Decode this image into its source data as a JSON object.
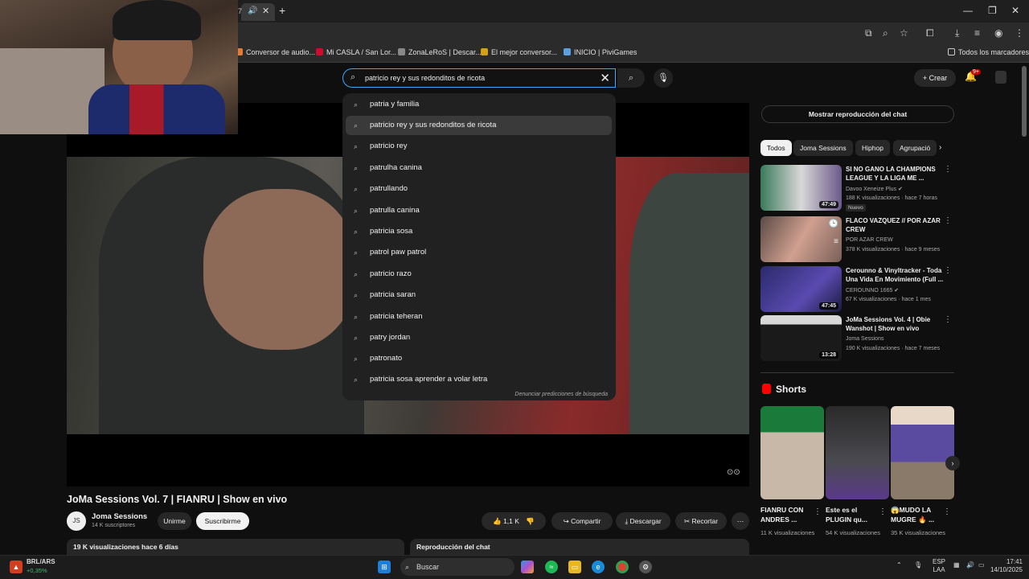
{
  "browser": {
    "tab_number": "7",
    "bookmarks": [
      {
        "label": "Conversor de audio...",
        "color": "#e07b39"
      },
      {
        "label": "Mi CASLA / San Lor...",
        "color": "#c8102e"
      },
      {
        "label": "ZonaLeRoS | Descar...",
        "color": "#888888"
      },
      {
        "label": "El mejor conversor...",
        "color": "#d4a017"
      },
      {
        "label": "INICIO | PiviGames",
        "color": "#5aa0e0"
      }
    ],
    "all_bookmarks": "Todos los marcadores"
  },
  "search": {
    "query": "patricio rey y sus redonditos de ricota",
    "suggestions": [
      "patria y familia",
      "patricio rey y sus redonditos de ricota",
      "patricio rey",
      "patrulha canina",
      "patrullando",
      "patrulla canina",
      "patricia sosa",
      "patrol paw patrol",
      "patricio razo",
      "patricia saran",
      "patricia teheran",
      "patry jordan",
      "patronato",
      "patricia sosa aprender a volar letra"
    ],
    "highlighted_index": 1,
    "report_label": "Denunciar predicciones de búsqueda"
  },
  "header": {
    "create_label": "Crear",
    "notif_count": "9+"
  },
  "video": {
    "title": "JoMa Sessions Vol. 7 | FIANRU | Show en vivo",
    "channel": "Joma Sessions",
    "channel_avatar": "JS",
    "subscribers": "14 K suscriptores",
    "join_label": "Unirme",
    "subscribe_label": "Suscribirme",
    "likes": "1,1 K",
    "share_label": "Compartir",
    "download_label": "Descargar",
    "clip_label": "Recortar",
    "views_date": "19 K visualizaciones  hace 6 días",
    "chat_replay_label": "Reproducción del chat"
  },
  "sidebar": {
    "show_chat_label": "Mostrar reproducción del chat",
    "chips": [
      "Todos",
      "Joma Sessions",
      "Hiphop",
      "Agrupació"
    ],
    "recommendations": [
      {
        "title": "SI NO GANO LA CHAMPIONS LEAGUE Y LA LIGA ME ...",
        "channel": "Davoo Xeneize Plus ✔",
        "meta": "188 K visualizaciones · hace 7 horas",
        "badge": "Nuevo",
        "duration": "47:49"
      },
      {
        "title": "FLACO VAZQUEZ // POR AZAR CREW",
        "channel": "POR AZAR CREW",
        "meta": "378 K visualizaciones · hace 9 meses",
        "badge": "",
        "duration": ""
      },
      {
        "title": "Cerounno & Vinyltracker - Toda Una Vida En Movimiento (Full ...",
        "channel": "CEROUNNO 1665 ✔",
        "meta": "67 K visualizaciones · hace 1 mes",
        "badge": "",
        "duration": "47:45"
      },
      {
        "title": "JoMa Sessions Vol. 4 | Obie Wanshot | Show en vivo",
        "channel": "Joma Sessions",
        "meta": "190 K visualizaciones · hace 7 meses",
        "badge": "",
        "duration": "13:28"
      }
    ],
    "shorts_label": "Shorts",
    "shorts": [
      {
        "title": "FIANRU CON ANDRES ...",
        "views": "11 K visualizaciones"
      },
      {
        "title": "Este es el PLUGIN qu...",
        "views": "54 K visualizaciones"
      },
      {
        "title": "😱MUDO LA MUGRE 🔥 ...",
        "views": "35 K visualizaciones"
      }
    ]
  },
  "taskbar": {
    "stock_name": "BRL/ARS",
    "stock_change": "+0,35%",
    "search_label": "Buscar",
    "lang": "ESP",
    "region": "LAA",
    "time": "17:41",
    "date": "14/10/2025"
  },
  "colors": {
    "accent_blue": "#3ea6ff",
    "youtube_red": "#ff0000",
    "background": "#0f0f0f"
  }
}
